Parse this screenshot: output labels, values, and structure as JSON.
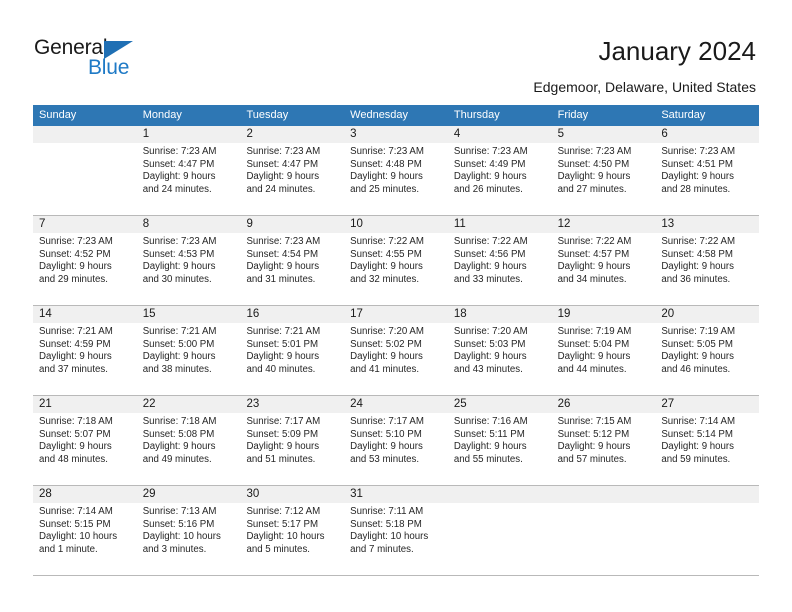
{
  "brand": {
    "word1": "General",
    "word2": "Blue",
    "triangle_color": "#1f6fb4",
    "blue_color": "#1f7ac6"
  },
  "header": {
    "title": "January 2024",
    "subtitle": "Edgemoor, Delaware, United States",
    "header_bg": "#2e77b4",
    "daynum_bg": "#f0f0f0"
  },
  "weekdays": [
    "Sunday",
    "Monday",
    "Tuesday",
    "Wednesday",
    "Thursday",
    "Friday",
    "Saturday"
  ],
  "weeks": [
    [
      {
        "day": "",
        "sunrise": "",
        "sunset": "",
        "daylight1": "",
        "daylight2": ""
      },
      {
        "day": "1",
        "sunrise": "Sunrise: 7:23 AM",
        "sunset": "Sunset: 4:47 PM",
        "daylight1": "Daylight: 9 hours",
        "daylight2": "and 24 minutes."
      },
      {
        "day": "2",
        "sunrise": "Sunrise: 7:23 AM",
        "sunset": "Sunset: 4:47 PM",
        "daylight1": "Daylight: 9 hours",
        "daylight2": "and 24 minutes."
      },
      {
        "day": "3",
        "sunrise": "Sunrise: 7:23 AM",
        "sunset": "Sunset: 4:48 PM",
        "daylight1": "Daylight: 9 hours",
        "daylight2": "and 25 minutes."
      },
      {
        "day": "4",
        "sunrise": "Sunrise: 7:23 AM",
        "sunset": "Sunset: 4:49 PM",
        "daylight1": "Daylight: 9 hours",
        "daylight2": "and 26 minutes."
      },
      {
        "day": "5",
        "sunrise": "Sunrise: 7:23 AM",
        "sunset": "Sunset: 4:50 PM",
        "daylight1": "Daylight: 9 hours",
        "daylight2": "and 27 minutes."
      },
      {
        "day": "6",
        "sunrise": "Sunrise: 7:23 AM",
        "sunset": "Sunset: 4:51 PM",
        "daylight1": "Daylight: 9 hours",
        "daylight2": "and 28 minutes."
      }
    ],
    [
      {
        "day": "7",
        "sunrise": "Sunrise: 7:23 AM",
        "sunset": "Sunset: 4:52 PM",
        "daylight1": "Daylight: 9 hours",
        "daylight2": "and 29 minutes."
      },
      {
        "day": "8",
        "sunrise": "Sunrise: 7:23 AM",
        "sunset": "Sunset: 4:53 PM",
        "daylight1": "Daylight: 9 hours",
        "daylight2": "and 30 minutes."
      },
      {
        "day": "9",
        "sunrise": "Sunrise: 7:23 AM",
        "sunset": "Sunset: 4:54 PM",
        "daylight1": "Daylight: 9 hours",
        "daylight2": "and 31 minutes."
      },
      {
        "day": "10",
        "sunrise": "Sunrise: 7:22 AM",
        "sunset": "Sunset: 4:55 PM",
        "daylight1": "Daylight: 9 hours",
        "daylight2": "and 32 minutes."
      },
      {
        "day": "11",
        "sunrise": "Sunrise: 7:22 AM",
        "sunset": "Sunset: 4:56 PM",
        "daylight1": "Daylight: 9 hours",
        "daylight2": "and 33 minutes."
      },
      {
        "day": "12",
        "sunrise": "Sunrise: 7:22 AM",
        "sunset": "Sunset: 4:57 PM",
        "daylight1": "Daylight: 9 hours",
        "daylight2": "and 34 minutes."
      },
      {
        "day": "13",
        "sunrise": "Sunrise: 7:22 AM",
        "sunset": "Sunset: 4:58 PM",
        "daylight1": "Daylight: 9 hours",
        "daylight2": "and 36 minutes."
      }
    ],
    [
      {
        "day": "14",
        "sunrise": "Sunrise: 7:21 AM",
        "sunset": "Sunset: 4:59 PM",
        "daylight1": "Daylight: 9 hours",
        "daylight2": "and 37 minutes."
      },
      {
        "day": "15",
        "sunrise": "Sunrise: 7:21 AM",
        "sunset": "Sunset: 5:00 PM",
        "daylight1": "Daylight: 9 hours",
        "daylight2": "and 38 minutes."
      },
      {
        "day": "16",
        "sunrise": "Sunrise: 7:21 AM",
        "sunset": "Sunset: 5:01 PM",
        "daylight1": "Daylight: 9 hours",
        "daylight2": "and 40 minutes."
      },
      {
        "day": "17",
        "sunrise": "Sunrise: 7:20 AM",
        "sunset": "Sunset: 5:02 PM",
        "daylight1": "Daylight: 9 hours",
        "daylight2": "and 41 minutes."
      },
      {
        "day": "18",
        "sunrise": "Sunrise: 7:20 AM",
        "sunset": "Sunset: 5:03 PM",
        "daylight1": "Daylight: 9 hours",
        "daylight2": "and 43 minutes."
      },
      {
        "day": "19",
        "sunrise": "Sunrise: 7:19 AM",
        "sunset": "Sunset: 5:04 PM",
        "daylight1": "Daylight: 9 hours",
        "daylight2": "and 44 minutes."
      },
      {
        "day": "20",
        "sunrise": "Sunrise: 7:19 AM",
        "sunset": "Sunset: 5:05 PM",
        "daylight1": "Daylight: 9 hours",
        "daylight2": "and 46 minutes."
      }
    ],
    [
      {
        "day": "21",
        "sunrise": "Sunrise: 7:18 AM",
        "sunset": "Sunset: 5:07 PM",
        "daylight1": "Daylight: 9 hours",
        "daylight2": "and 48 minutes."
      },
      {
        "day": "22",
        "sunrise": "Sunrise: 7:18 AM",
        "sunset": "Sunset: 5:08 PM",
        "daylight1": "Daylight: 9 hours",
        "daylight2": "and 49 minutes."
      },
      {
        "day": "23",
        "sunrise": "Sunrise: 7:17 AM",
        "sunset": "Sunset: 5:09 PM",
        "daylight1": "Daylight: 9 hours",
        "daylight2": "and 51 minutes."
      },
      {
        "day": "24",
        "sunrise": "Sunrise: 7:17 AM",
        "sunset": "Sunset: 5:10 PM",
        "daylight1": "Daylight: 9 hours",
        "daylight2": "and 53 minutes."
      },
      {
        "day": "25",
        "sunrise": "Sunrise: 7:16 AM",
        "sunset": "Sunset: 5:11 PM",
        "daylight1": "Daylight: 9 hours",
        "daylight2": "and 55 minutes."
      },
      {
        "day": "26",
        "sunrise": "Sunrise: 7:15 AM",
        "sunset": "Sunset: 5:12 PM",
        "daylight1": "Daylight: 9 hours",
        "daylight2": "and 57 minutes."
      },
      {
        "day": "27",
        "sunrise": "Sunrise: 7:14 AM",
        "sunset": "Sunset: 5:14 PM",
        "daylight1": "Daylight: 9 hours",
        "daylight2": "and 59 minutes."
      }
    ],
    [
      {
        "day": "28",
        "sunrise": "Sunrise: 7:14 AM",
        "sunset": "Sunset: 5:15 PM",
        "daylight1": "Daylight: 10 hours",
        "daylight2": "and 1 minute."
      },
      {
        "day": "29",
        "sunrise": "Sunrise: 7:13 AM",
        "sunset": "Sunset: 5:16 PM",
        "daylight1": "Daylight: 10 hours",
        "daylight2": "and 3 minutes."
      },
      {
        "day": "30",
        "sunrise": "Sunrise: 7:12 AM",
        "sunset": "Sunset: 5:17 PM",
        "daylight1": "Daylight: 10 hours",
        "daylight2": "and 5 minutes."
      },
      {
        "day": "31",
        "sunrise": "Sunrise: 7:11 AM",
        "sunset": "Sunset: 5:18 PM",
        "daylight1": "Daylight: 10 hours",
        "daylight2": "and 7 minutes."
      },
      {
        "day": "",
        "sunrise": "",
        "sunset": "",
        "daylight1": "",
        "daylight2": ""
      },
      {
        "day": "",
        "sunrise": "",
        "sunset": "",
        "daylight1": "",
        "daylight2": ""
      },
      {
        "day": "",
        "sunrise": "",
        "sunset": "",
        "daylight1": "",
        "daylight2": ""
      }
    ]
  ]
}
